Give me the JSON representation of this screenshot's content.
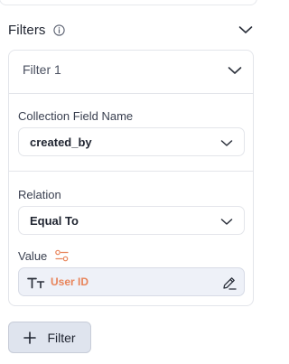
{
  "section": {
    "title": "Filters"
  },
  "filter_card": {
    "title": "Filter 1",
    "collection_field": {
      "label": "Collection Field Name",
      "value": "created_by"
    },
    "relation": {
      "label": "Relation",
      "value": "Equal To"
    },
    "value": {
      "label": "Value",
      "text": "User ID"
    }
  },
  "add_button": {
    "label": "Filter"
  },
  "colors": {
    "accent_orange": "#e8845a",
    "value_bg": "#eef1f8",
    "button_bg": "#dfe4ee",
    "border": "#e3e5ea"
  }
}
